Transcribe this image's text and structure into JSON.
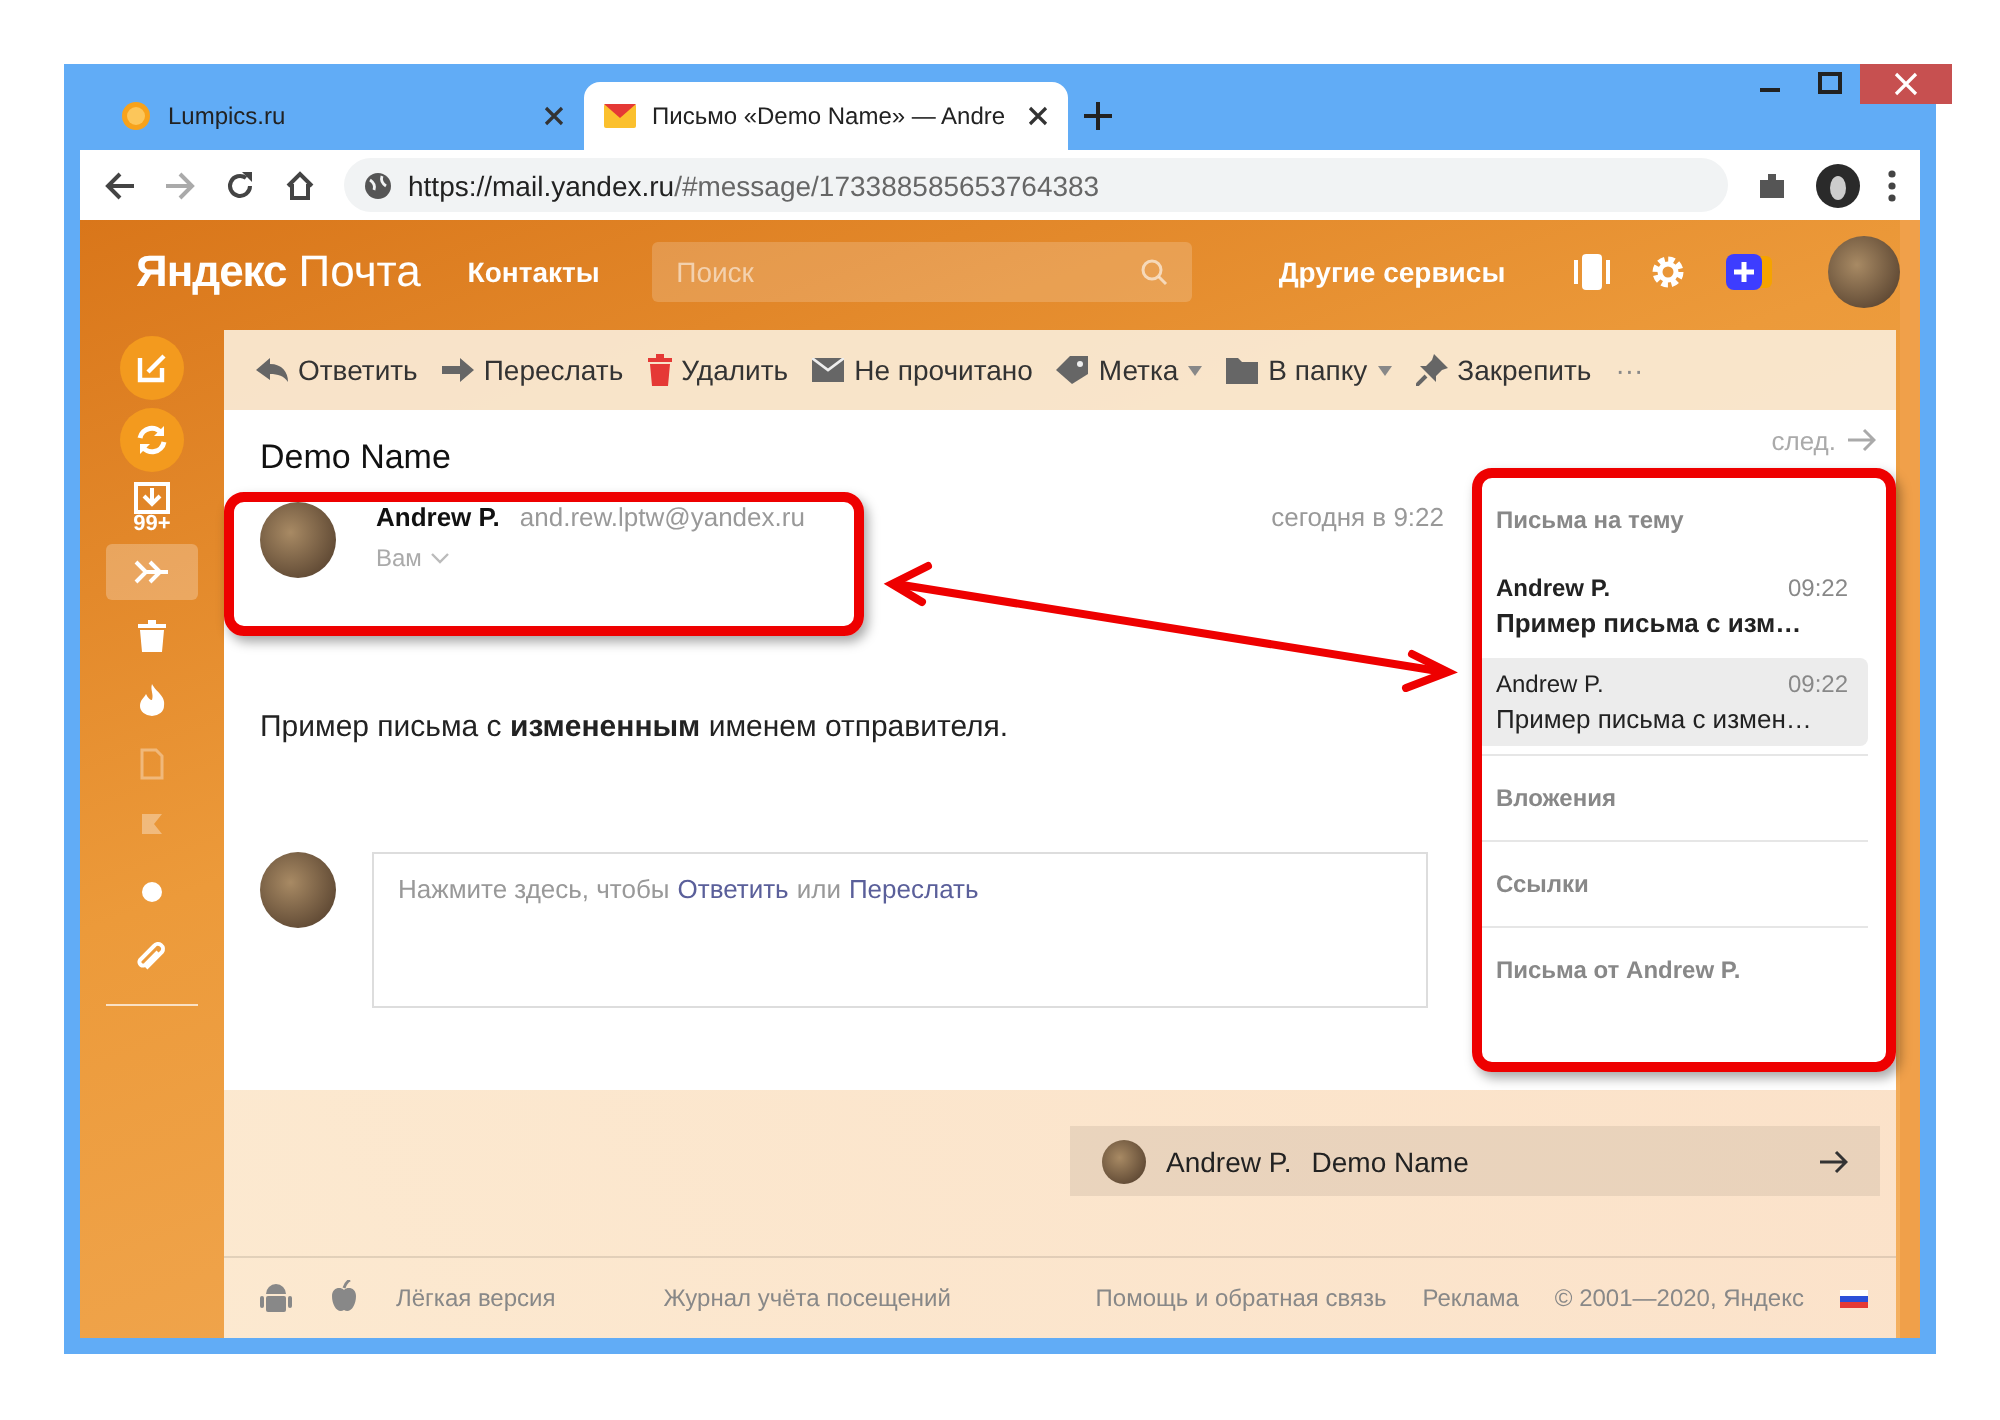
{
  "browser": {
    "tabs": [
      {
        "title": "Lumpics.ru",
        "kind": "site",
        "selected": false
      },
      {
        "title": "Письмо «Demo Name» — Andre",
        "kind": "mail",
        "selected": true
      }
    ],
    "url_host": "https://mail.yandex.ru",
    "url_path": "/#message/173388585653764383"
  },
  "header": {
    "logo_brand": "Яндекс",
    "logo_service": "Почта",
    "contacts": "Контакты",
    "search": {
      "placeholder": "Поиск"
    },
    "other_services": "Другие сервисы"
  },
  "sidebar": {
    "items": [
      {
        "kind": "compose",
        "selected": false,
        "disabled": false
      },
      {
        "kind": "refresh",
        "selected": false,
        "disabled": false
      },
      {
        "kind": "inbox",
        "badge": "99+",
        "selected": false,
        "disabled": false
      },
      {
        "kind": "sent",
        "selected": true,
        "disabled": false
      },
      {
        "kind": "trash",
        "selected": false,
        "disabled": false
      },
      {
        "kind": "spam",
        "selected": false,
        "disabled": false
      },
      {
        "kind": "drafts",
        "selected": false,
        "disabled": true
      },
      {
        "kind": "flag",
        "selected": false,
        "disabled": true
      },
      {
        "kind": "unread",
        "selected": false,
        "disabled": false
      },
      {
        "kind": "attachments",
        "selected": false,
        "disabled": false
      }
    ]
  },
  "toolbar": [
    {
      "kind": "reply",
      "label": "Ответить",
      "caret": false
    },
    {
      "kind": "forward",
      "label": "Переслать",
      "caret": false
    },
    {
      "kind": "delete",
      "label": "Удалить",
      "caret": false
    },
    {
      "kind": "unread",
      "label": "Не прочитано",
      "caret": false
    },
    {
      "kind": "label",
      "label": "Метка",
      "caret": true
    },
    {
      "kind": "folder",
      "label": "В папку",
      "caret": true
    },
    {
      "kind": "pin",
      "label": "Закрепить",
      "caret": false
    },
    {
      "kind": "more",
      "label": "···",
      "caret": false
    }
  ],
  "message": {
    "subject": "Demo Name",
    "next": "след.",
    "sender_name": "Andrew P.",
    "sender_email": "and.rew.lptw@yandex.ru",
    "recipient": "Вам",
    "date": "сегодня в 9:22",
    "body": "Пример письма с **измененным** именем отправителя.",
    "reply_box": {
      "before": "Нажмите здесь, чтобы",
      "reply": "Ответить",
      "middle": "или",
      "forward": "Переслать"
    }
  },
  "thread_panel": {
    "heading": "Письма на тему",
    "items": [
      {
        "sender": "Andrew P.",
        "time": "09:22",
        "snippet": "Пример письма с изм…",
        "unread": true,
        "selected": false
      },
      {
        "sender": "Andrew P.",
        "time": "09:22",
        "snippet": "Пример письма с измен…",
        "unread": false,
        "selected": true
      }
    ],
    "links": [
      "Вложения",
      "Ссылки",
      "Письма от Andrew P."
    ]
  },
  "next_bar": {
    "sender": "Andrew P.",
    "subject": "Demo Name"
  },
  "footer": {
    "links": [
      "Лёгкая версия",
      "Журнал учёта посещений",
      "Помощь и обратная связь",
      "Реклама"
    ],
    "copyright": "© 2001—2020, Яндекс"
  }
}
